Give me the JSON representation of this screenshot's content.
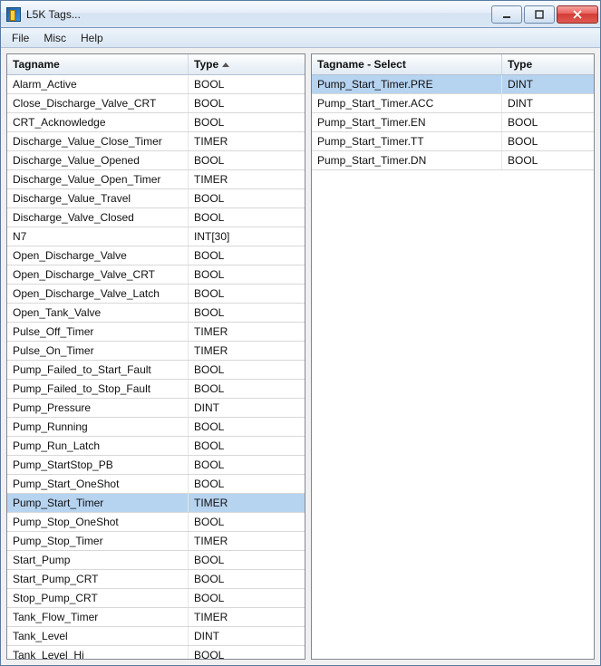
{
  "window": {
    "title": "L5K Tags..."
  },
  "menu": {
    "file": "File",
    "misc": "Misc",
    "help": "Help"
  },
  "left_panel": {
    "header_tagname": "Tagname",
    "header_type": "Type",
    "sort_column": "Type",
    "rows": [
      {
        "name": "Alarm_Active",
        "type": "BOOL"
      },
      {
        "name": "Close_Discharge_Valve_CRT",
        "type": "BOOL"
      },
      {
        "name": "CRT_Acknowledge",
        "type": "BOOL"
      },
      {
        "name": "Discharge_Value_Close_Timer",
        "type": "TIMER"
      },
      {
        "name": "Discharge_Value_Opened",
        "type": "BOOL"
      },
      {
        "name": "Discharge_Value_Open_Timer",
        "type": "TIMER"
      },
      {
        "name": "Discharge_Value_Travel",
        "type": "BOOL"
      },
      {
        "name": "Discharge_Valve_Closed",
        "type": "BOOL"
      },
      {
        "name": "N7",
        "type": "INT[30]"
      },
      {
        "name": "Open_Discharge_Valve",
        "type": "BOOL"
      },
      {
        "name": "Open_Discharge_Valve_CRT",
        "type": "BOOL"
      },
      {
        "name": "Open_Discharge_Valve_Latch",
        "type": "BOOL"
      },
      {
        "name": "Open_Tank_Valve",
        "type": "BOOL"
      },
      {
        "name": "Pulse_Off_Timer",
        "type": "TIMER"
      },
      {
        "name": "Pulse_On_Timer",
        "type": "TIMER"
      },
      {
        "name": "Pump_Failed_to_Start_Fault",
        "type": "BOOL"
      },
      {
        "name": "Pump_Failed_to_Stop_Fault",
        "type": "BOOL"
      },
      {
        "name": "Pump_Pressure",
        "type": "DINT"
      },
      {
        "name": "Pump_Running",
        "type": "BOOL"
      },
      {
        "name": "Pump_Run_Latch",
        "type": "BOOL"
      },
      {
        "name": "Pump_StartStop_PB",
        "type": "BOOL"
      },
      {
        "name": "Pump_Start_OneShot",
        "type": "BOOL"
      },
      {
        "name": "Pump_Start_Timer",
        "type": "TIMER",
        "selected": true
      },
      {
        "name": "Pump_Stop_OneShot",
        "type": "BOOL"
      },
      {
        "name": "Pump_Stop_Timer",
        "type": "TIMER"
      },
      {
        "name": "Start_Pump",
        "type": "BOOL"
      },
      {
        "name": "Start_Pump_CRT",
        "type": "BOOL"
      },
      {
        "name": "Stop_Pump_CRT",
        "type": "BOOL"
      },
      {
        "name": "Tank_Flow_Timer",
        "type": "TIMER"
      },
      {
        "name": "Tank_Level",
        "type": "DINT"
      },
      {
        "name": "Tank_Level_Hi",
        "type": "BOOL"
      }
    ]
  },
  "right_panel": {
    "header_tagname": "Tagname - Select",
    "header_type": "Type",
    "rows": [
      {
        "name": "Pump_Start_Timer.PRE",
        "type": "DINT",
        "selected": true
      },
      {
        "name": "Pump_Start_Timer.ACC",
        "type": "DINT"
      },
      {
        "name": "Pump_Start_Timer.EN",
        "type": "BOOL"
      },
      {
        "name": "Pump_Start_Timer.TT",
        "type": "BOOL"
      },
      {
        "name": "Pump_Start_Timer.DN",
        "type": "BOOL"
      }
    ]
  }
}
